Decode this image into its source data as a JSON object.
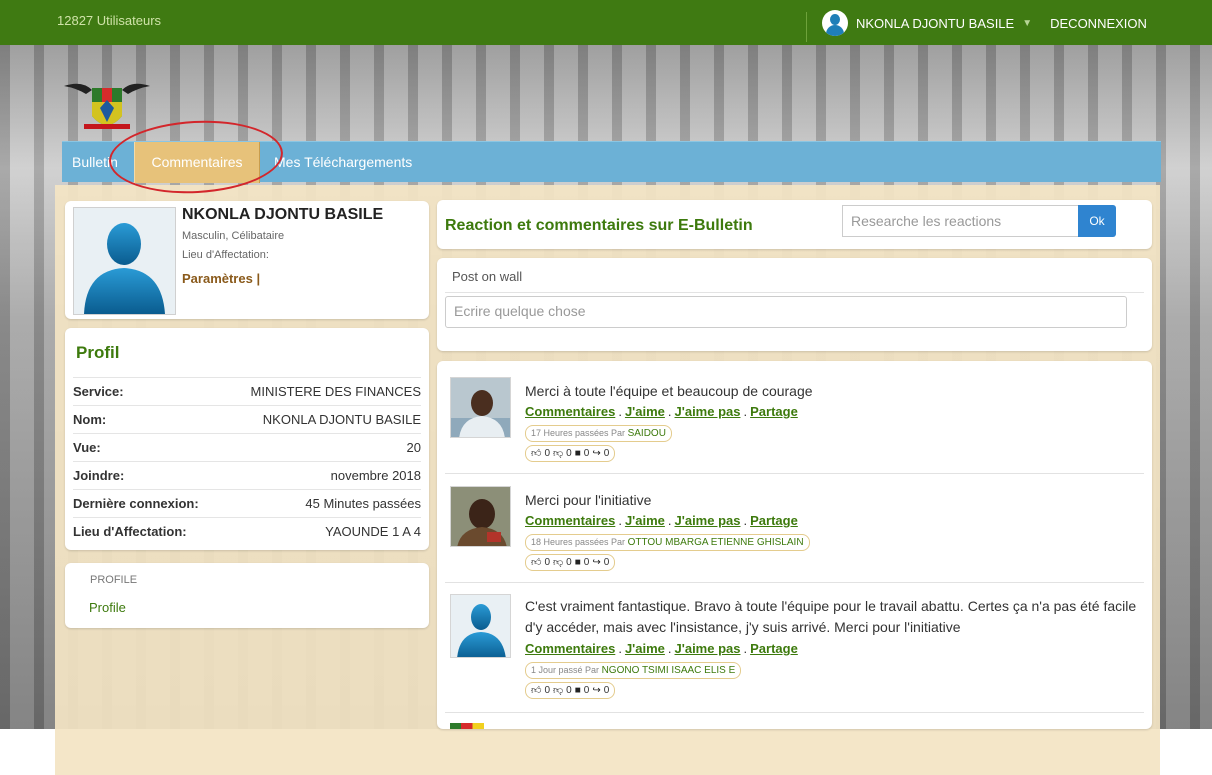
{
  "topbar": {
    "users_count": "12827 Utilisateurs",
    "user_name": "NKONLA DJONTU BASILE",
    "logout": "DECONNEXION"
  },
  "nav": {
    "bulletin": "Bulletin",
    "comments": "Commentaires",
    "downloads": "Mes Téléchargements"
  },
  "user_card": {
    "name": "NKONLA DJONTU BASILE",
    "meta": "Masculin, Célibataire",
    "affectation_label": "Lieu d'Affectation:",
    "settings": "Paramètres |"
  },
  "profile": {
    "title": "Profil",
    "rows": [
      {
        "k": "Service:",
        "v": "MINISTERE DES FINANCES"
      },
      {
        "k": "Nom:",
        "v": "NKONLA DJONTU BASILE"
      },
      {
        "k": "Vue:",
        "v": "20"
      },
      {
        "k": "Joindre:",
        "v": "novembre 2018"
      },
      {
        "k": "Dernière connexion:",
        "v": "45 Minutes passées"
      },
      {
        "k": "Lieu d'Affectation:",
        "v": "YAOUNDE 1 A 4"
      }
    ]
  },
  "side_menu": {
    "header": "PROFILE",
    "link": "Profile"
  },
  "feed_header": {
    "title": "Reaction et commentaires sur E-Bulletin",
    "search_placeholder": "Researche les reactions",
    "ok": "Ok"
  },
  "post_box": {
    "label": "Post on wall",
    "placeholder": "Ecrire quelque chose"
  },
  "actions": {
    "comments": "Commentaires",
    "like": "J'aime",
    "dislike": "J'aime pas",
    "share": "Partage",
    "sep": "."
  },
  "posts": [
    {
      "text": "Merci à toute l'équipe et beaucoup de courage",
      "time": "17 Heures passées Par",
      "author": "SAIDOU",
      "likes": "0",
      "dislikes": "0",
      "comments": "0",
      "shares": "0"
    },
    {
      "text": "Merci pour l'initiative",
      "time": "18 Heures passées Par",
      "author": "OTTOU MBARGA ETIENNE GHISLAIN",
      "likes": "0",
      "dislikes": "0",
      "comments": "0",
      "shares": "0"
    },
    {
      "text": "C'est vraiment fantastique. Bravo à toute l'équipe pour le travail abattu. Certes ça n'a pas été facile d'y accéder, mais avec l'insistance, j'y suis arrivé. Merci pour l'initiative",
      "time": "1 Jour passé Par",
      "author": "NGONO TSIMI ISAAC ELIS E",
      "likes": "0",
      "dislikes": "0",
      "comments": "0",
      "shares": "0"
    }
  ],
  "colors": {
    "topbar": "#3f7a12",
    "nav": "#6cb1d6",
    "nav_active": "#e7c27a",
    "accent_green": "#3d7a0d",
    "highlight": "#d3262b"
  }
}
